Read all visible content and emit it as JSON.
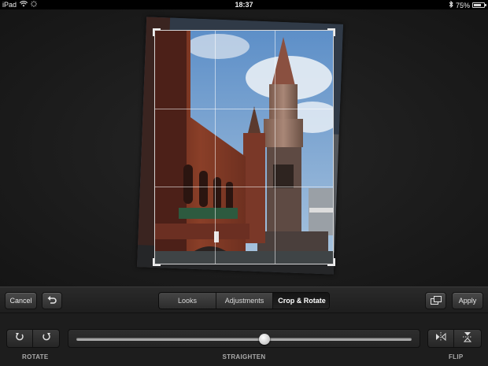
{
  "status": {
    "device": "iPad",
    "time": "18:37",
    "battery": "75%",
    "battery_fraction": 0.75
  },
  "toolbar": {
    "cancel_label": "Cancel",
    "apply_label": "Apply",
    "tabs": [
      {
        "label": "Looks"
      },
      {
        "label": "Adjustments"
      },
      {
        "label": "Crop & Rotate",
        "active": true
      }
    ]
  },
  "controls": {
    "rotate_label": "ROTATE",
    "straighten_label": "STRAIGHTEN",
    "flip_label": "FLIP",
    "straighten_value": 0.56
  },
  "icons": {
    "wifi": "wifi-icon",
    "activity": "activity-icon",
    "bluetooth": "bluetooth-icon",
    "undo": "undo-icon",
    "compare": "compare-icon",
    "rotate_left": "rotate-left-icon",
    "rotate_right": "rotate-right-icon",
    "flip_horizontal": "flip-horizontal-icon",
    "flip_vertical": "flip-vertical-icon"
  }
}
